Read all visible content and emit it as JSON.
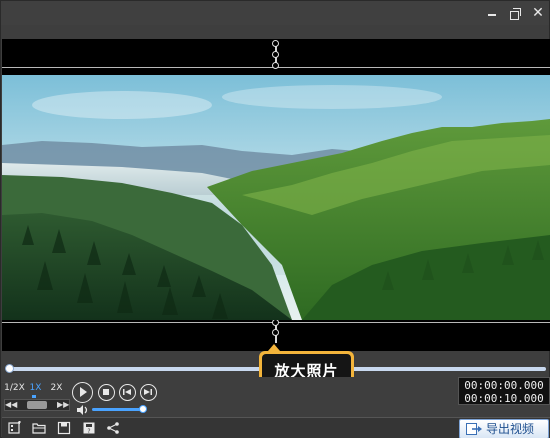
{
  "window": {
    "controls": [
      "minimize-icon",
      "restore-icon",
      "close-icon"
    ],
    "close_glyph": "✕"
  },
  "stage": {
    "background": "#000000",
    "photo_description_icon": "landscape-photo"
  },
  "tooltip": {
    "label": "放大照片",
    "accent": "#f3b43b"
  },
  "playback": {
    "speeds": [
      "1/2X",
      "1X",
      "2X"
    ],
    "active_speed": "1X",
    "progress": 0.0,
    "volume": 1.0,
    "current_time": "00:00:00.000",
    "total_time": "00:00:10.000"
  },
  "toolbar": {
    "icons": [
      "add-media-icon",
      "open-folder-icon",
      "save-icon",
      "save-as-icon",
      "share-icon"
    ],
    "export_label": "导出视频"
  },
  "colors": {
    "accent_blue": "#4aa3ff",
    "panel": "#3e3e3e"
  }
}
